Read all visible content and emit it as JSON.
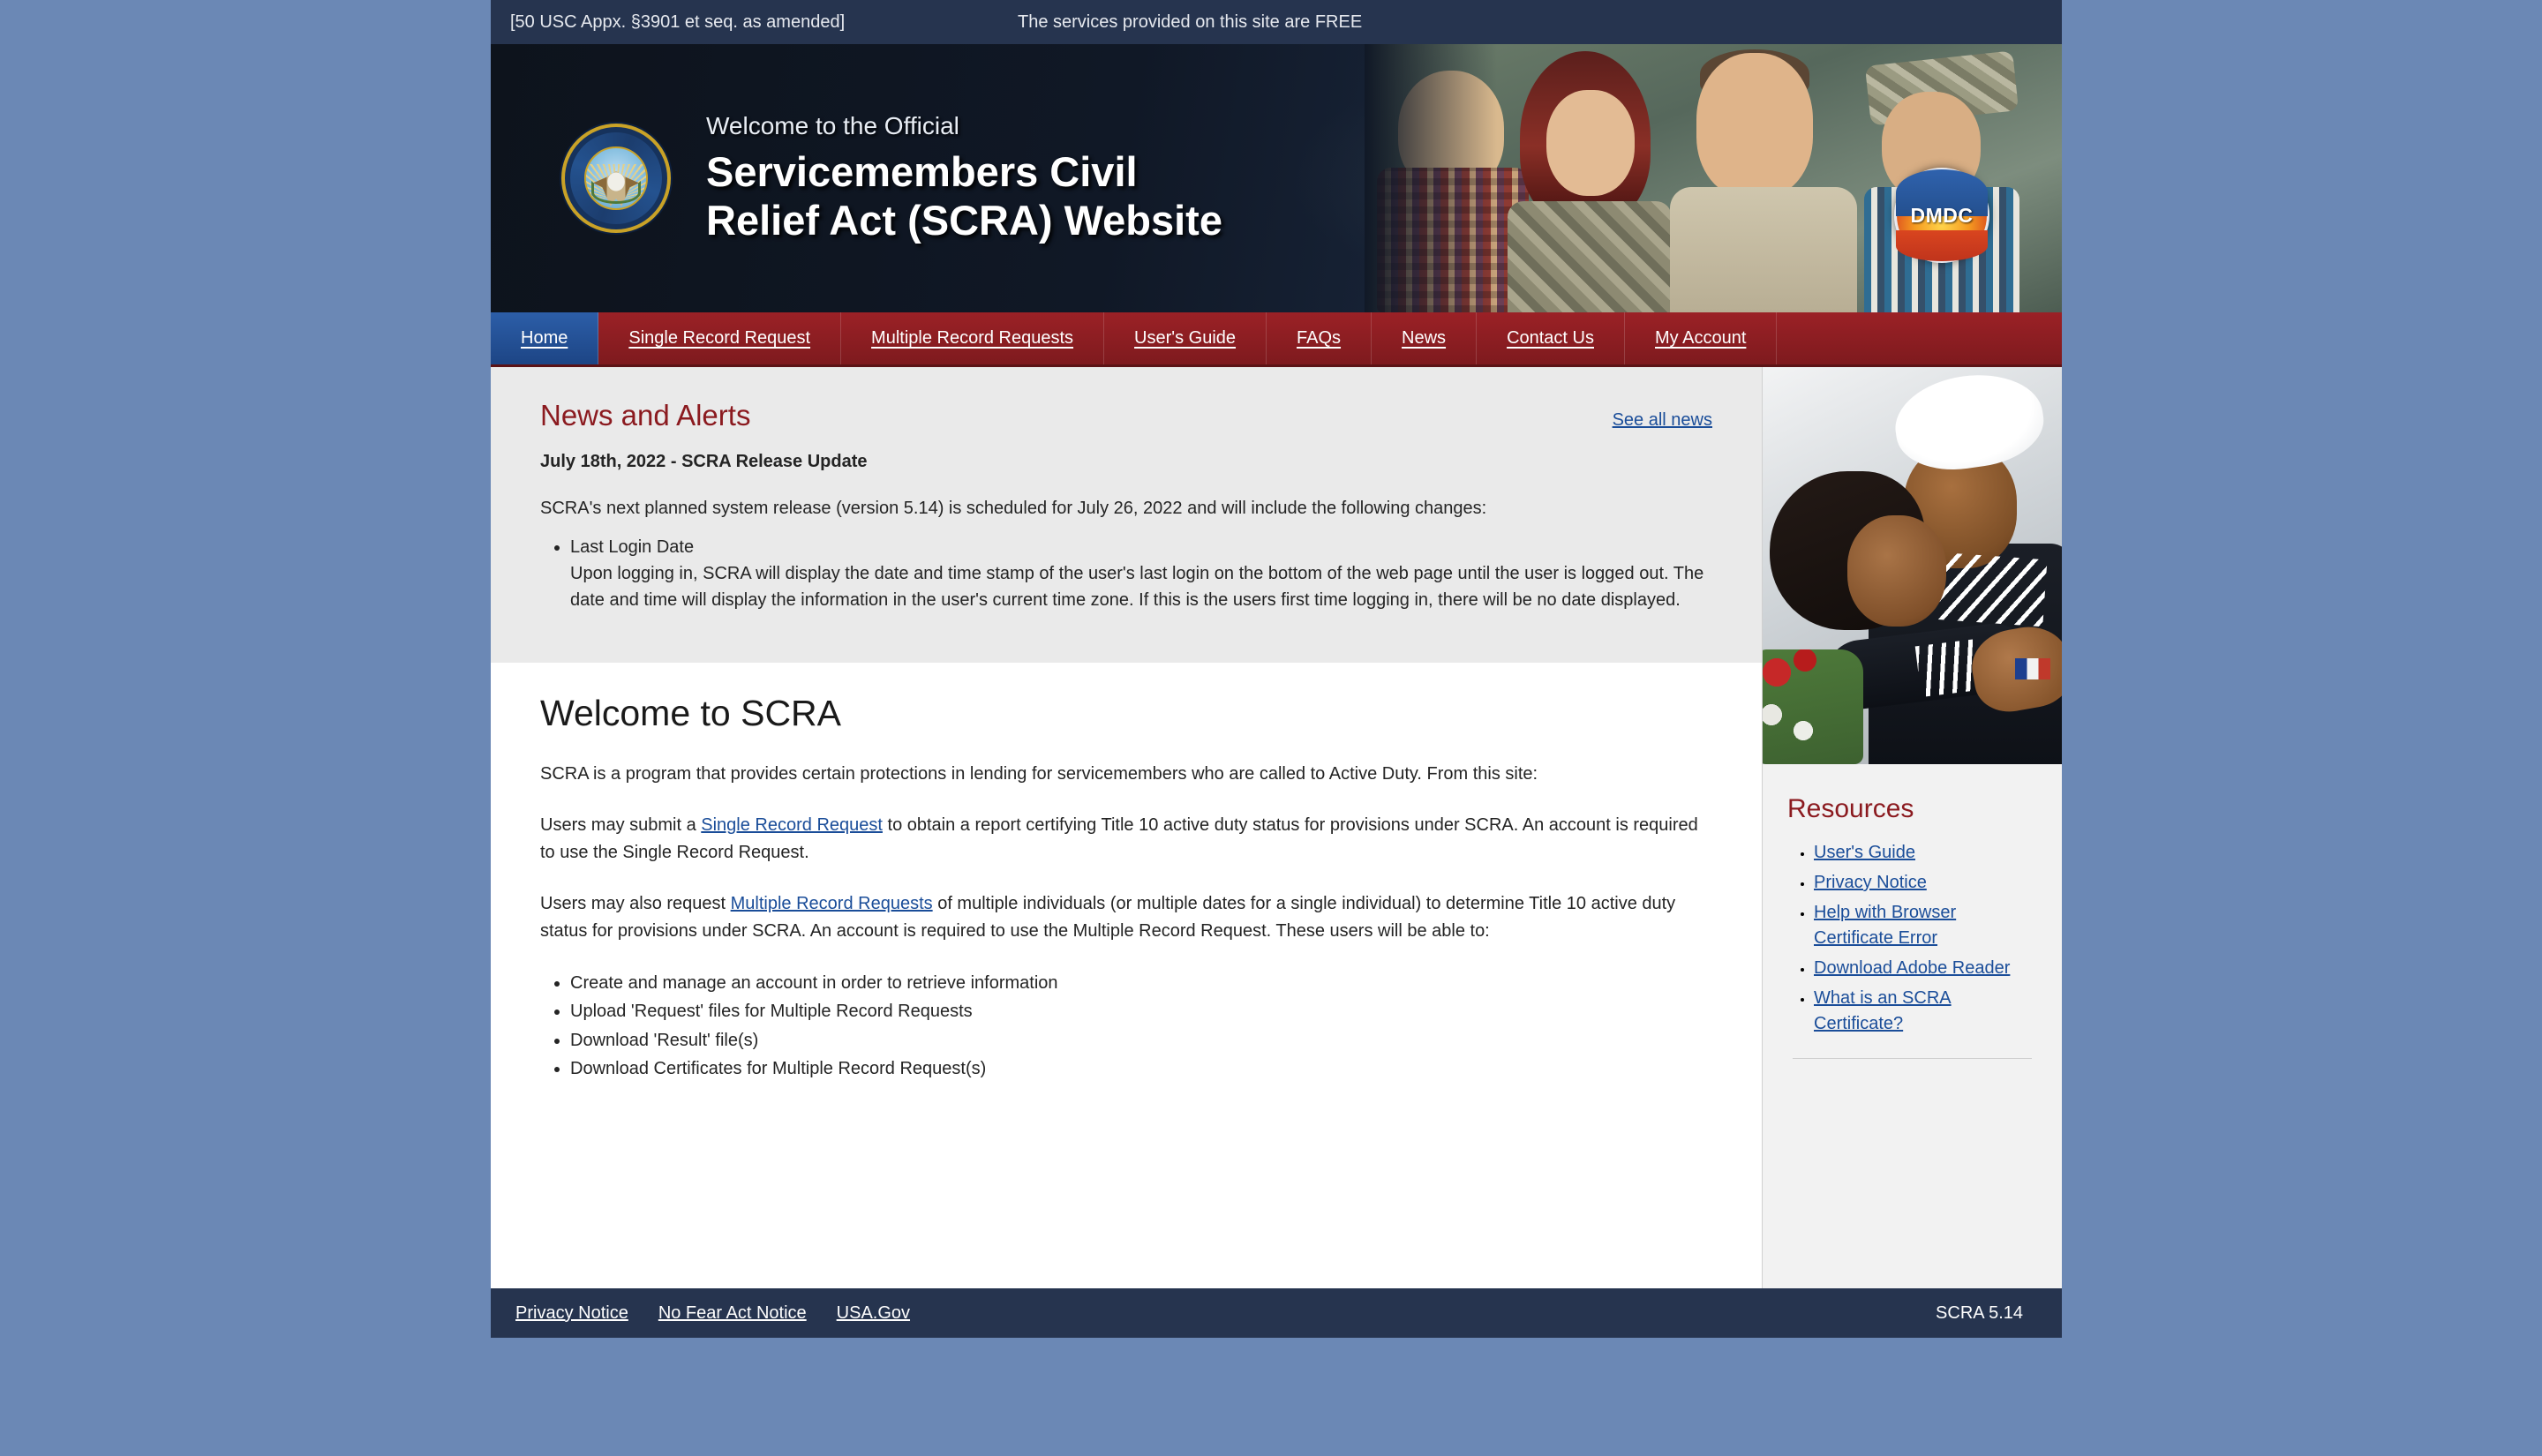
{
  "topbar": {
    "usc_citation": "[50 USC Appx. §3901 et seq. as amended]",
    "free_notice": "The services provided on this site are FREE"
  },
  "banner": {
    "welcome_line": "Welcome to the Official",
    "title_line1": "Servicemembers Civil",
    "title_line2": "Relief Act (SCRA) Website",
    "seal_name": "dod-seal",
    "dmdc_label": "DMDC"
  },
  "nav": {
    "items": [
      {
        "label": "Home",
        "active": true
      },
      {
        "label": "Single Record Request",
        "active": false
      },
      {
        "label": "Multiple Record Requests",
        "active": false
      },
      {
        "label": "User's Guide",
        "active": false
      },
      {
        "label": "FAQs",
        "active": false
      },
      {
        "label": "News",
        "active": false
      },
      {
        "label": "Contact Us",
        "active": false
      },
      {
        "label": "My Account",
        "active": false
      }
    ]
  },
  "news": {
    "heading": "News and Alerts",
    "see_all_label": "See all news",
    "date_title": "July 18th, 2022 - SCRA Release Update",
    "intro": "SCRA's next planned system release (version 5.14) is scheduled for July 26, 2022 and will include the following changes:",
    "bullet_title": "Last Login Date",
    "bullet_detail": "Upon logging in, SCRA will display the date and time stamp of the user's last login on the bottom of the web page until the user is logged out. The date and time will display the information in the user's current time zone. If this is the users first time logging in, there will be no date displayed."
  },
  "main": {
    "heading": "Welcome to SCRA",
    "para1": "SCRA is a program that provides certain protections in lending for servicemembers who are called to Active Duty. From this site:",
    "para2_pre": "Users may submit a ",
    "para2_link": "Single Record Request",
    "para2_post": " to obtain a report certifying Title 10 active duty status for provisions under SCRA. An account is required to use the Single Record Request.",
    "para3_pre": "Users may also request ",
    "para3_link": "Multiple Record Requests",
    "para3_post": " of multiple individuals (or multiple dates for a single individual) to determine Title 10 active duty status for provisions under SCRA. An account is required to use the Multiple Record Request. These users will be able to:",
    "capabilities": [
      "Create and manage an account in order to retrieve information",
      "Upload 'Request' files for Multiple Record Requests",
      "Download 'Result' file(s)",
      "Download Certificates for Multiple Record Request(s)"
    ]
  },
  "sidebar": {
    "photo_name": "sailor-reunion-photo",
    "resources_heading": "Resources",
    "links": [
      "User's Guide",
      "Privacy Notice",
      "Help with Browser Certificate Error",
      "Download Adobe Reader",
      "What is an SCRA Certificate?"
    ]
  },
  "footer": {
    "links": [
      "Privacy Notice",
      "No Fear Act Notice",
      "USA.Gov"
    ],
    "version": "SCRA 5.14"
  },
  "colors": {
    "page_background": "#6b88b5",
    "topbar": "#26344f",
    "nav_red": "#8b1a1f",
    "nav_active_blue": "#1d4585",
    "heading_red": "#8b1a1f",
    "link_blue": "#1a4d99",
    "news_panel": "#eaeaea",
    "sidebar": "#f2f2f2",
    "footer": "#26344f"
  }
}
